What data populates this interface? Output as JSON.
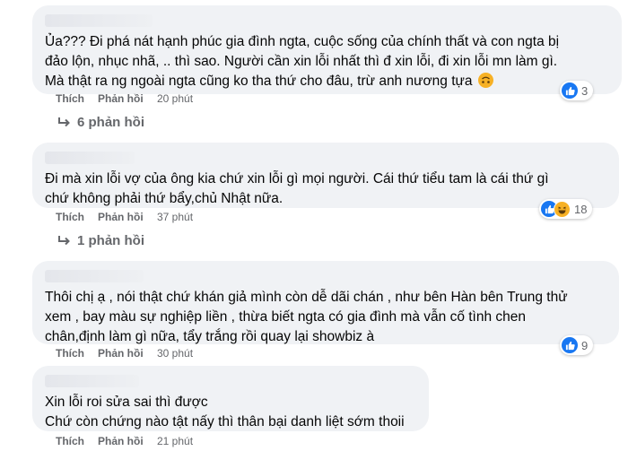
{
  "comments": [
    {
      "lines": [
        "Ủa??? Đi phá nát hạnh phúc gia đình ngta, cuộc sống của chính thất và con ngta bị",
        "đảo lộn, nhục nhã, .. thì sao. Người cần xin lỗi nhất thì đ xin lỗi, đi xin lỗi mn làm gì.",
        "Mà thật ra ng ngoài ngta cũng ko tha thứ cho đâu, trừ anh nương tựa"
      ],
      "emoji": "upside-down-face-emoji",
      "like_label": "Thích",
      "reply_label": "Phản hồi",
      "time": "20 phút",
      "reactions": {
        "icons": [
          "like-icon"
        ],
        "count": "3"
      },
      "replies_label": "6 phản hồi"
    },
    {
      "lines": [
        "Đi mà xin lỗi vợ của ông kia chứ xin lỗi gì mọi người. Cái thứ tiểu tam là cái thứ gì",
        "chứ không phải thứ bẩy,chủ Nhật nữa."
      ],
      "like_label": "Thích",
      "reply_label": "Phản hồi",
      "time": "37 phút",
      "reactions": {
        "icons": [
          "like-icon",
          "haha-icon"
        ],
        "count": "18"
      },
      "replies_label": "1 phản hồi"
    },
    {
      "lines": [
        "Thôi chị ạ , nói thật chứ khán giả mình còn dễ dãi chán , như bên Hàn bên Trung thử",
        "xem , bay màu sự nghiệp liền , thừa biết ngta có gia đình mà vẫn cố tình chen",
        "chân,định làm gì nữa, tẩy trắng rồi quay lại showbiz à"
      ],
      "like_label": "Thích",
      "reply_label": "Phản hồi",
      "time": "30 phút",
      "reactions": {
        "icons": [
          "like-icon"
        ],
        "count": "9"
      }
    },
    {
      "lines": [
        "Xin lỗi roi sửa sai thì được",
        "Chứ còn chứng nào tật nấy thì thân bại danh liệt sớm thoii"
      ],
      "like_label": "Thích",
      "reply_label": "Phản hồi",
      "time": "21 phút"
    }
  ],
  "colors": {
    "bubble": "#f0f2f5",
    "secondary_text": "#65676b",
    "like_blue": "#1877f2",
    "haha_yellow": "#f7b125"
  }
}
